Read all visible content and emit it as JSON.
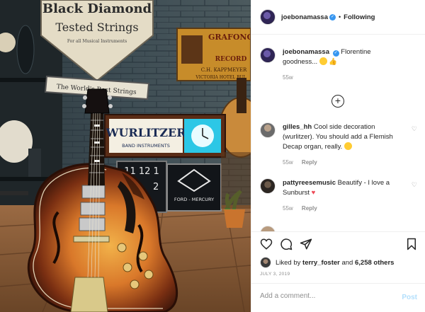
{
  "post": {
    "image_alt": "Sunburst archtop guitar in front of vintage signs",
    "signs": {
      "black_diamond_line1": "Black Diamond",
      "black_diamond_line2": "Tested Strings",
      "black_diamond_tagline": "For all Musical Instruments",
      "worlds_best": "The World's Best Strings",
      "grafonola_line1": "GRAFONO",
      "grafonola_line2": "RECORD",
      "grafonola_line3": "C.H. KAPPMEYER",
      "grafonola_line4": "VICTORIA HOTEL BUL",
      "wurlitzer_name": "WURLITZER",
      "wurlitzer_sub": "BAND INSTRUMENTS",
      "ford_line1": "FORD - MERCURY",
      "clock_left_digits": "11 12 1"
    }
  },
  "header": {
    "username": "joebonamassa",
    "separator": "•",
    "follow_status": "Following"
  },
  "caption": {
    "username": "joebonamassa",
    "text": "Florentine goodness...",
    "time": "55w"
  },
  "comments": [
    {
      "username": "gilles_hh",
      "text": "Cool side decoration (wurlitzer). You should add a Flemish Decap organ, really.",
      "time": "55w",
      "reply": "Reply"
    },
    {
      "username": "pattyreesemusic",
      "text": "Beautify - I love a Sunburst",
      "time": "55w",
      "reply": "Reply"
    }
  ],
  "likes": {
    "prefix": "Liked by",
    "user": "terry_foster",
    "and": "and",
    "count": "6,258 others"
  },
  "date": "JULY 3, 2019",
  "add_comment": {
    "placeholder": "Add a comment...",
    "post_label": "Post"
  },
  "colors": {
    "accent_blue": "#3897f0",
    "post_disabled": "#b2dffc",
    "heart_red": "#ed4956",
    "muted": "#8e8e8e"
  }
}
